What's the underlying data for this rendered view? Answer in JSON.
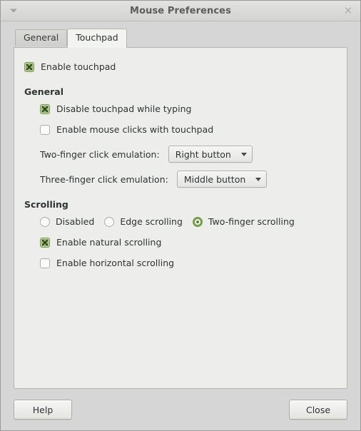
{
  "window": {
    "title": "Mouse Preferences",
    "menu_icon": "triangle-down-icon",
    "close_icon": "×"
  },
  "tabs": [
    {
      "label": "General",
      "active": false
    },
    {
      "label": "Touchpad",
      "active": true
    }
  ],
  "touchpad": {
    "enable_touchpad": {
      "label": "Enable touchpad",
      "checked": true
    },
    "general_section": {
      "heading": "General",
      "options": [
        {
          "label": "Disable touchpad while typing",
          "checked": true
        },
        {
          "label": "Enable mouse clicks with touchpad",
          "checked": false
        }
      ],
      "combos": [
        {
          "label": "Two-finger click emulation:",
          "value": "Right button",
          "arrow_icon": "chevron-down-icon"
        },
        {
          "label": "Three-finger click emulation:",
          "value": "Middle button",
          "arrow_icon": "chevron-down-icon"
        }
      ]
    },
    "scrolling_section": {
      "heading": "Scrolling",
      "radios": [
        {
          "label": "Disabled",
          "selected": false
        },
        {
          "label": "Edge scrolling",
          "selected": false
        },
        {
          "label": "Two-finger scrolling",
          "selected": true
        }
      ],
      "options": [
        {
          "label": "Enable natural scrolling",
          "checked": true
        },
        {
          "label": "Enable horizontal scrolling",
          "checked": false
        }
      ]
    }
  },
  "actions": {
    "help_label": "Help",
    "close_label": "Close"
  },
  "colors": {
    "accent_green": "#74a043",
    "check_fill": "#8fb16b",
    "window_bg": "#d6d6d6",
    "panel_bg": "#ededeb",
    "text": "#2e3436"
  }
}
